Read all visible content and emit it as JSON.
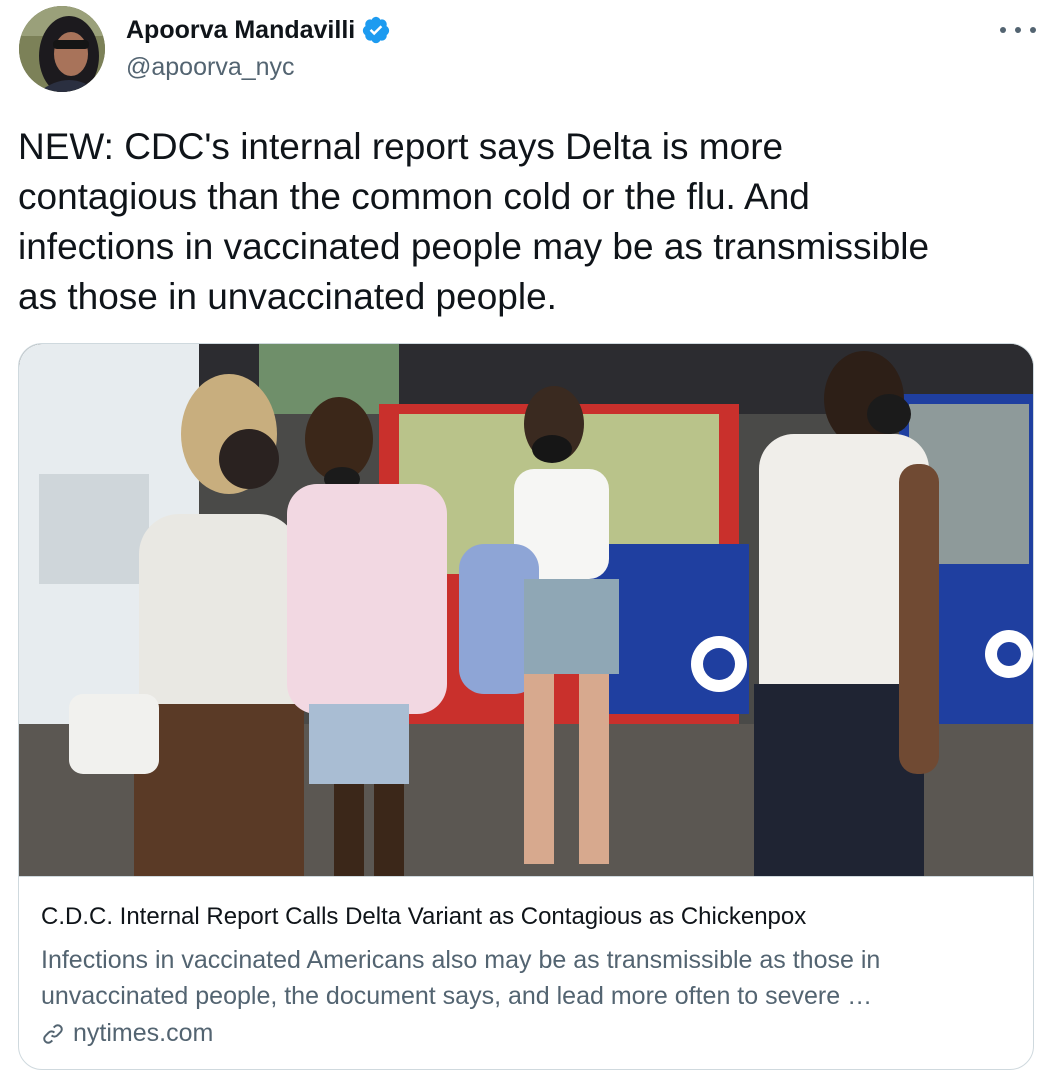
{
  "author": {
    "name": "Apoorva Mandavilli",
    "handle": "@apoorva_nyc",
    "verified": true,
    "verified_color": "#1d9bf0"
  },
  "tweet": {
    "text": "NEW: CDC's internal report says Delta is more\ncontagious than the common cold or the flu. And\ninfections in vaccinated people may be as transmissible\nas those in unvaccinated people."
  },
  "card": {
    "title": "C.D.C. Internal Report Calls Delta Variant as Contagious as Chickenpox",
    "description": "Infections in vaccinated Americans also may be as transmissible as those in unvaccinated people, the document says, and lead more often to severe …",
    "domain": "nytimes.com",
    "image_alt": "People wearing masks inside a sneaker store with claw machines",
    "link_icon": "link-icon"
  },
  "icons": {
    "more": "more-options-icon",
    "verified": "verified-badge-icon"
  },
  "colors": {
    "text_primary": "#0f1419",
    "text_secondary": "#536471",
    "border": "#cfd9de"
  }
}
